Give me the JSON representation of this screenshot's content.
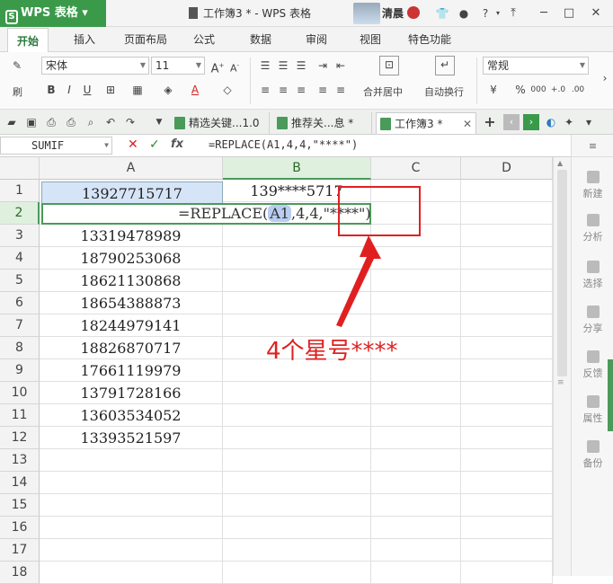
{
  "titlebar": {
    "app_name": "WPS 表格",
    "doc_title": "工作簿3 * - WPS 表格",
    "user_name": "清晨",
    "help_icon": "?"
  },
  "ribbon_tabs": [
    "开始",
    "插入",
    "页面布局",
    "公式",
    "数据",
    "审阅",
    "视图",
    "特色功能"
  ],
  "toolbar": {
    "font_name": "宋体",
    "font_size": "11",
    "number_format": "常规",
    "merge_label": "合并居中",
    "wrap_label": "自动换行",
    "paste_label": "刷",
    "percent": "%",
    "thousands": "000"
  },
  "doc_tabs": [
    {
      "label": "精选关键...1.0"
    },
    {
      "label": "推荐关...息 *"
    },
    {
      "label": "工作簿3 *"
    }
  ],
  "formula_bar": {
    "name_box": "SUMIF",
    "formula": "=REPLACE(A1,4,4,\"****\")"
  },
  "columns": [
    "A",
    "B",
    "C",
    "D"
  ],
  "rows": [
    "1",
    "2",
    "3",
    "4",
    "5",
    "6",
    "7",
    "8",
    "9",
    "10",
    "11",
    "12",
    "13",
    "14",
    "15",
    "16",
    "17",
    "18"
  ],
  "cells": {
    "A1": "13927715717",
    "B1": "139****5717",
    "A3": "13319478989",
    "A4": "18790253068",
    "A5": "18621130868",
    "A6": "18654388873",
    "A7": "18244979141",
    "A8": "18826870717",
    "A9": "17661119979",
    "A10": "13791728166",
    "A11": "13603534052",
    "A12": "13393521597"
  },
  "edit": {
    "prefix": "=REPLACE(",
    "ref": "A1",
    "suffix": ",4,4,\"****\")"
  },
  "annotation": "4个星号****",
  "side_panel": [
    "新建",
    "分析",
    "选择",
    "分享",
    "反馈",
    "属性",
    "备份"
  ]
}
